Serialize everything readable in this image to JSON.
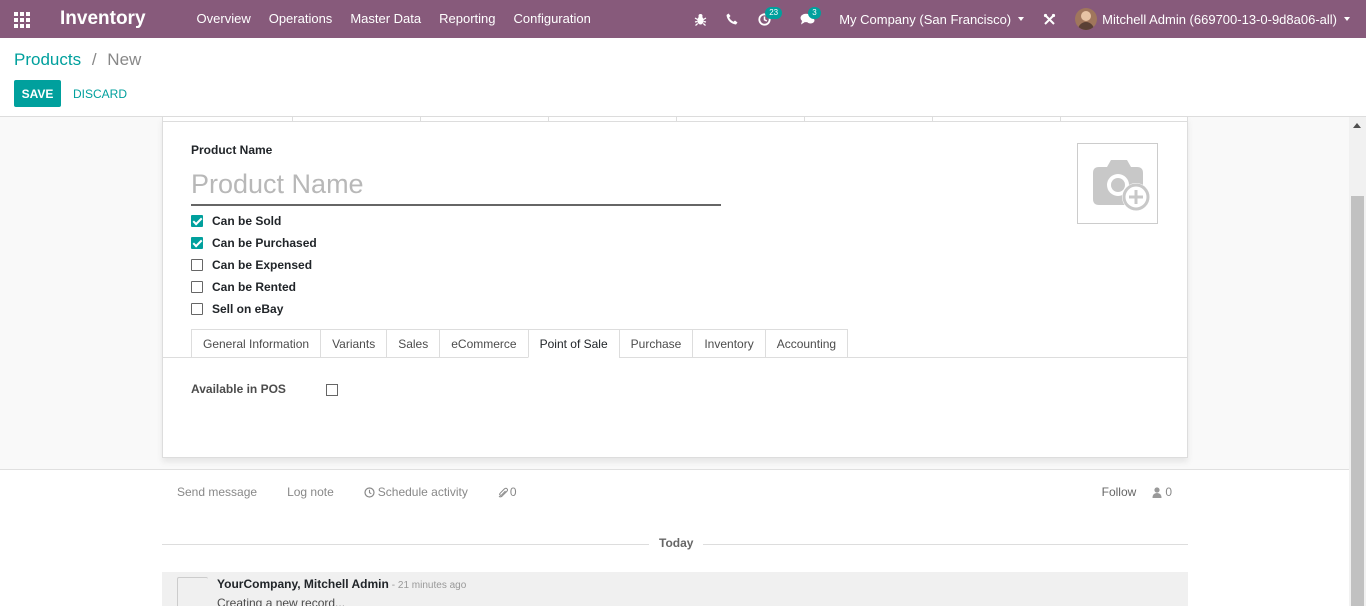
{
  "navbar": {
    "app_title": "Inventory",
    "menu": [
      "Overview",
      "Operations",
      "Master Data",
      "Reporting",
      "Configuration"
    ],
    "activity_count": "23",
    "message_count": "3",
    "company": "My Company (San Francisco)",
    "user": "Mitchell Admin (669700-13-0-9d8a06-all)"
  },
  "breadcrumb": {
    "parent": "Products",
    "separator": "/",
    "current": "New"
  },
  "buttons": {
    "save": "SAVE",
    "discard": "DISCARD"
  },
  "form": {
    "name_label": "Product Name",
    "name_placeholder": "Product Name",
    "checkboxes": [
      {
        "label": "Can be Sold",
        "checked": true
      },
      {
        "label": "Can be Purchased",
        "checked": true
      },
      {
        "label": "Can be Expensed",
        "checked": false
      },
      {
        "label": "Can be Rented",
        "checked": false
      },
      {
        "label": "Sell on eBay",
        "checked": false
      }
    ],
    "tabs": [
      "General Information",
      "Variants",
      "Sales",
      "eCommerce",
      "Point of Sale",
      "Purchase",
      "Inventory",
      "Accounting"
    ],
    "active_tab": "Point of Sale",
    "pos_field_label": "Available in POS",
    "pos_field_checked": false
  },
  "chatter": {
    "send_message": "Send message",
    "log_note": "Log note",
    "schedule_activity": "Schedule activity",
    "attachments_count": "0",
    "follow": "Follow",
    "followers_count": "0",
    "today": "Today",
    "message_author": "YourCompany, Mitchell Admin",
    "message_date": "- 21 minutes ago",
    "message_body": "Creating a new record..."
  },
  "colors": {
    "navbar": "#875a7b",
    "accent": "#00a09d"
  },
  "icons": [
    "apps-grid-icon",
    "bug-icon",
    "phone-icon",
    "activity-clock-icon",
    "chat-icon",
    "tools-icon",
    "camera-plus-icon",
    "clock-icon",
    "paperclip-icon",
    "user-icon"
  ]
}
